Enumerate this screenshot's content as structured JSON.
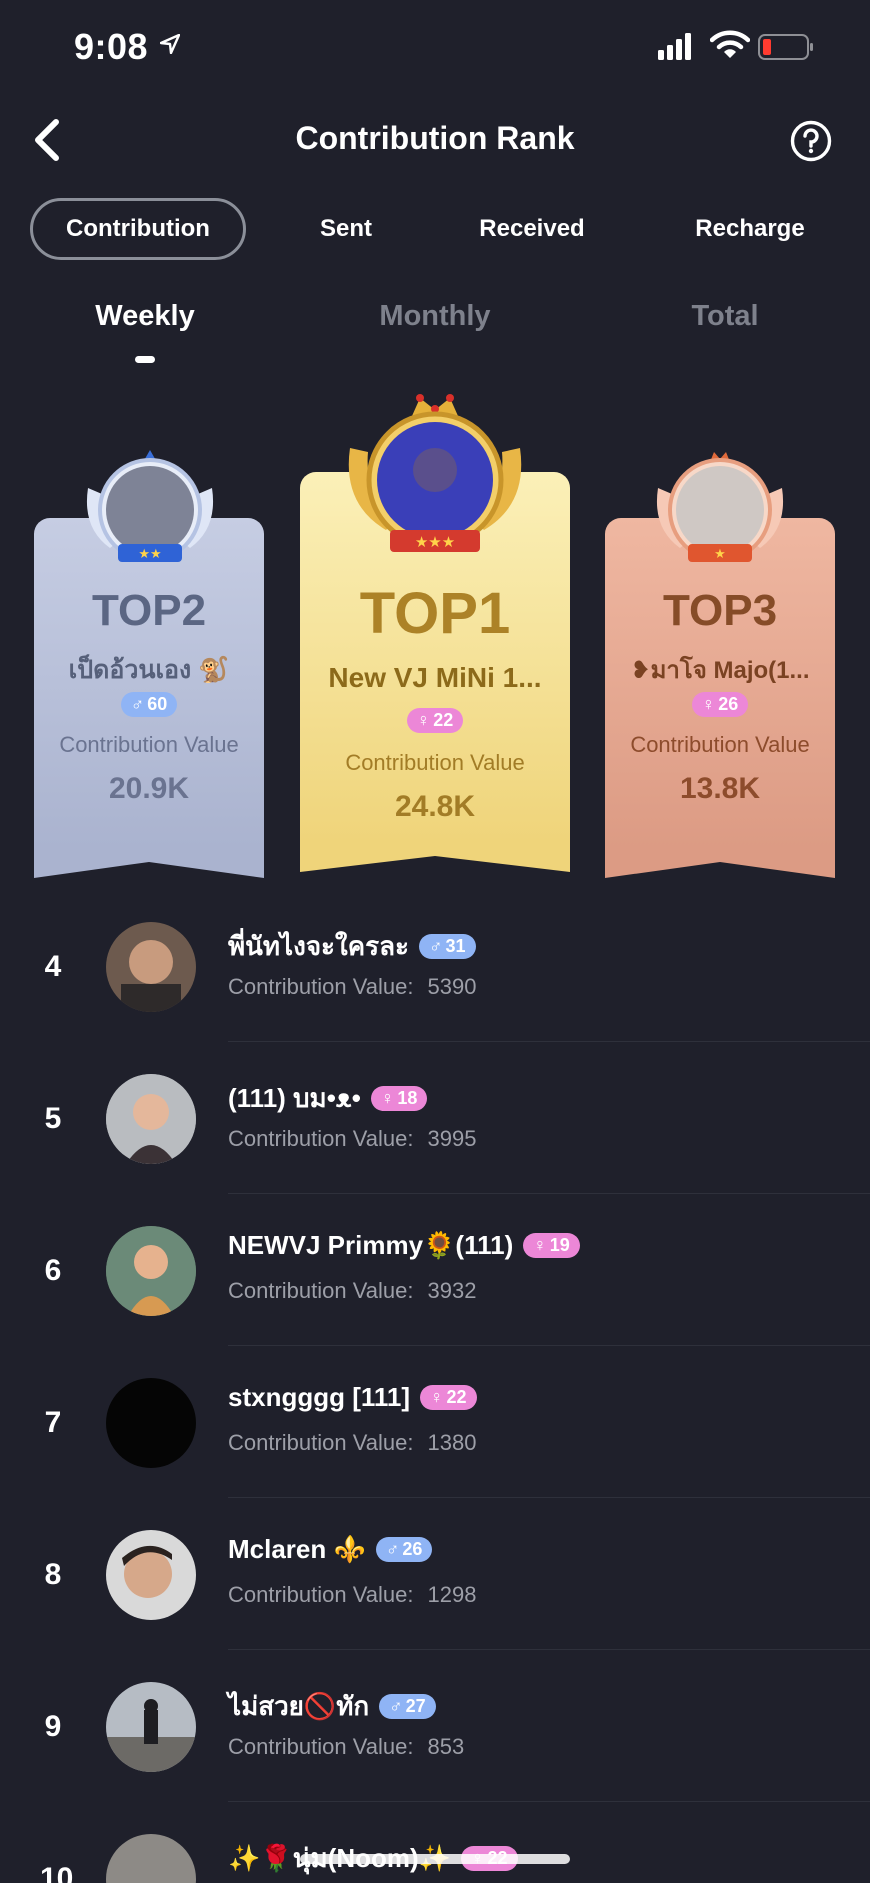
{
  "status": {
    "time": "9:08"
  },
  "header": {
    "title": "Contribution Rank"
  },
  "segments": [
    "Contribution",
    "Sent",
    "Received",
    "Recharge"
  ],
  "periods": [
    "Weekly",
    "Monthly",
    "Total"
  ],
  "podium": {
    "top2": {
      "label": "TOP2",
      "name": "เป็ดอ้วนเอง 🐒",
      "gender": "♂",
      "level": "60",
      "value_label": "Contribution Value",
      "value": "20.9K"
    },
    "top1": {
      "label": "TOP1",
      "name": "New VJ MiNi 1...",
      "gender": "♀",
      "level": "22",
      "value_label": "Contribution Value",
      "value": "24.8K"
    },
    "top3": {
      "label": "TOP3",
      "name": "❥มาโจ Majo(1...",
      "gender": "♀",
      "level": "26",
      "value_label": "Contribution Value",
      "value": "13.8K"
    }
  },
  "list": [
    {
      "rank": "4",
      "name": "พี่นัทไงจะใครละ",
      "gender": "♂",
      "level": "31",
      "value_label": "Contribution Value:",
      "value": "5390"
    },
    {
      "rank": "5",
      "name": "(111) บม•ᴥ•",
      "gender": "♀",
      "level": "18",
      "value_label": "Contribution Value:",
      "value": "3995"
    },
    {
      "rank": "6",
      "name": "NEWVJ Primmy🌻(111)",
      "gender": "♀",
      "level": "19",
      "value_label": "Contribution Value:",
      "value": "3932"
    },
    {
      "rank": "7",
      "name": "stxngggg [111]",
      "gender": "♀",
      "level": "22",
      "value_label": "Contribution Value:",
      "value": "1380"
    },
    {
      "rank": "8",
      "name": "Mclaren ⚜️",
      "gender": "♂",
      "level": "26",
      "value_label": "Contribution Value:",
      "value": "1298"
    },
    {
      "rank": "9",
      "name": "ไม่สวย🚫ทัก",
      "gender": "♂",
      "level": "27",
      "value_label": "Contribution Value:",
      "value": "853"
    },
    {
      "rank": "10",
      "name": "✨🌹นุ่ม(Noom)✨",
      "gender": "♀",
      "level": "22"
    }
  ]
}
